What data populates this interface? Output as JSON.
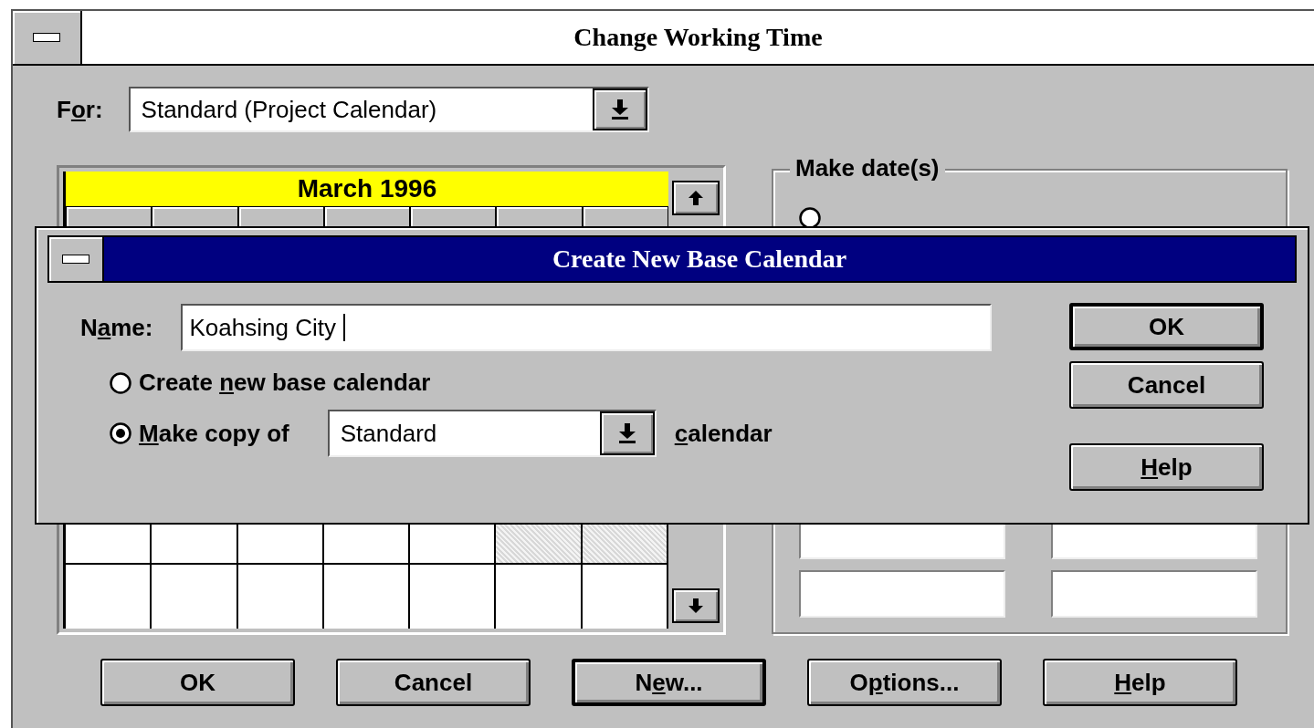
{
  "window": {
    "title": "Change Working Time"
  },
  "for_field": {
    "label": {
      "pre": "F",
      "key": "o",
      "post": "r:"
    },
    "value": "Standard (Project Calendar)"
  },
  "calendar": {
    "month": "March 1996",
    "weeks": [
      {
        "days": [
          {
            "nonworking": false
          },
          {
            "nonworking": false
          },
          {
            "nonworking": false
          },
          {
            "nonworking": false
          },
          {
            "nonworking": false
          },
          {
            "nonworking": true
          },
          {
            "nonworking": true
          }
        ]
      },
      {
        "days": [
          {
            "nonworking": false
          },
          {
            "nonworking": false
          },
          {
            "nonworking": false
          },
          {
            "nonworking": false
          },
          {
            "nonworking": false
          },
          {
            "nonworking": false
          },
          {
            "nonworking": false
          }
        ]
      }
    ]
  },
  "make_dates": {
    "title": "Make date(s)",
    "options": [
      {
        "selected": false
      }
    ]
  },
  "buttons": [
    {
      "label": {
        "pre": "OK"
      },
      "default": false
    },
    {
      "label": {
        "pre": "Cancel"
      },
      "default": false
    },
    {
      "label": {
        "pre": "N",
        "key": "e",
        "post": "w..."
      },
      "default": true
    },
    {
      "label": {
        "pre": "O",
        "key": "p",
        "post": "tions..."
      },
      "default": false
    },
    {
      "label": {
        "key": "H",
        "post": "elp"
      },
      "default": false
    }
  ],
  "dialog": {
    "title": "Create New Base Calendar",
    "name_label": {
      "pre": "N",
      "key": "a",
      "post": "me:"
    },
    "name_value": "Koahsing City",
    "options": [
      {
        "label": {
          "pre": "Create ",
          "key": "n",
          "post": "ew base calendar"
        },
        "selected": false
      },
      {
        "label": {
          "key": "M",
          "post": "ake copy of"
        },
        "selected": true
      }
    ],
    "copy_of": "Standard",
    "suffix": {
      "key": "c",
      "post": "alendar"
    },
    "buttons": [
      {
        "label": {
          "pre": "OK"
        },
        "default": true
      },
      {
        "label": {
          "pre": "Cancel"
        },
        "default": false
      },
      {
        "label": {
          "key": "H",
          "post": "elp"
        },
        "default": false
      }
    ]
  }
}
